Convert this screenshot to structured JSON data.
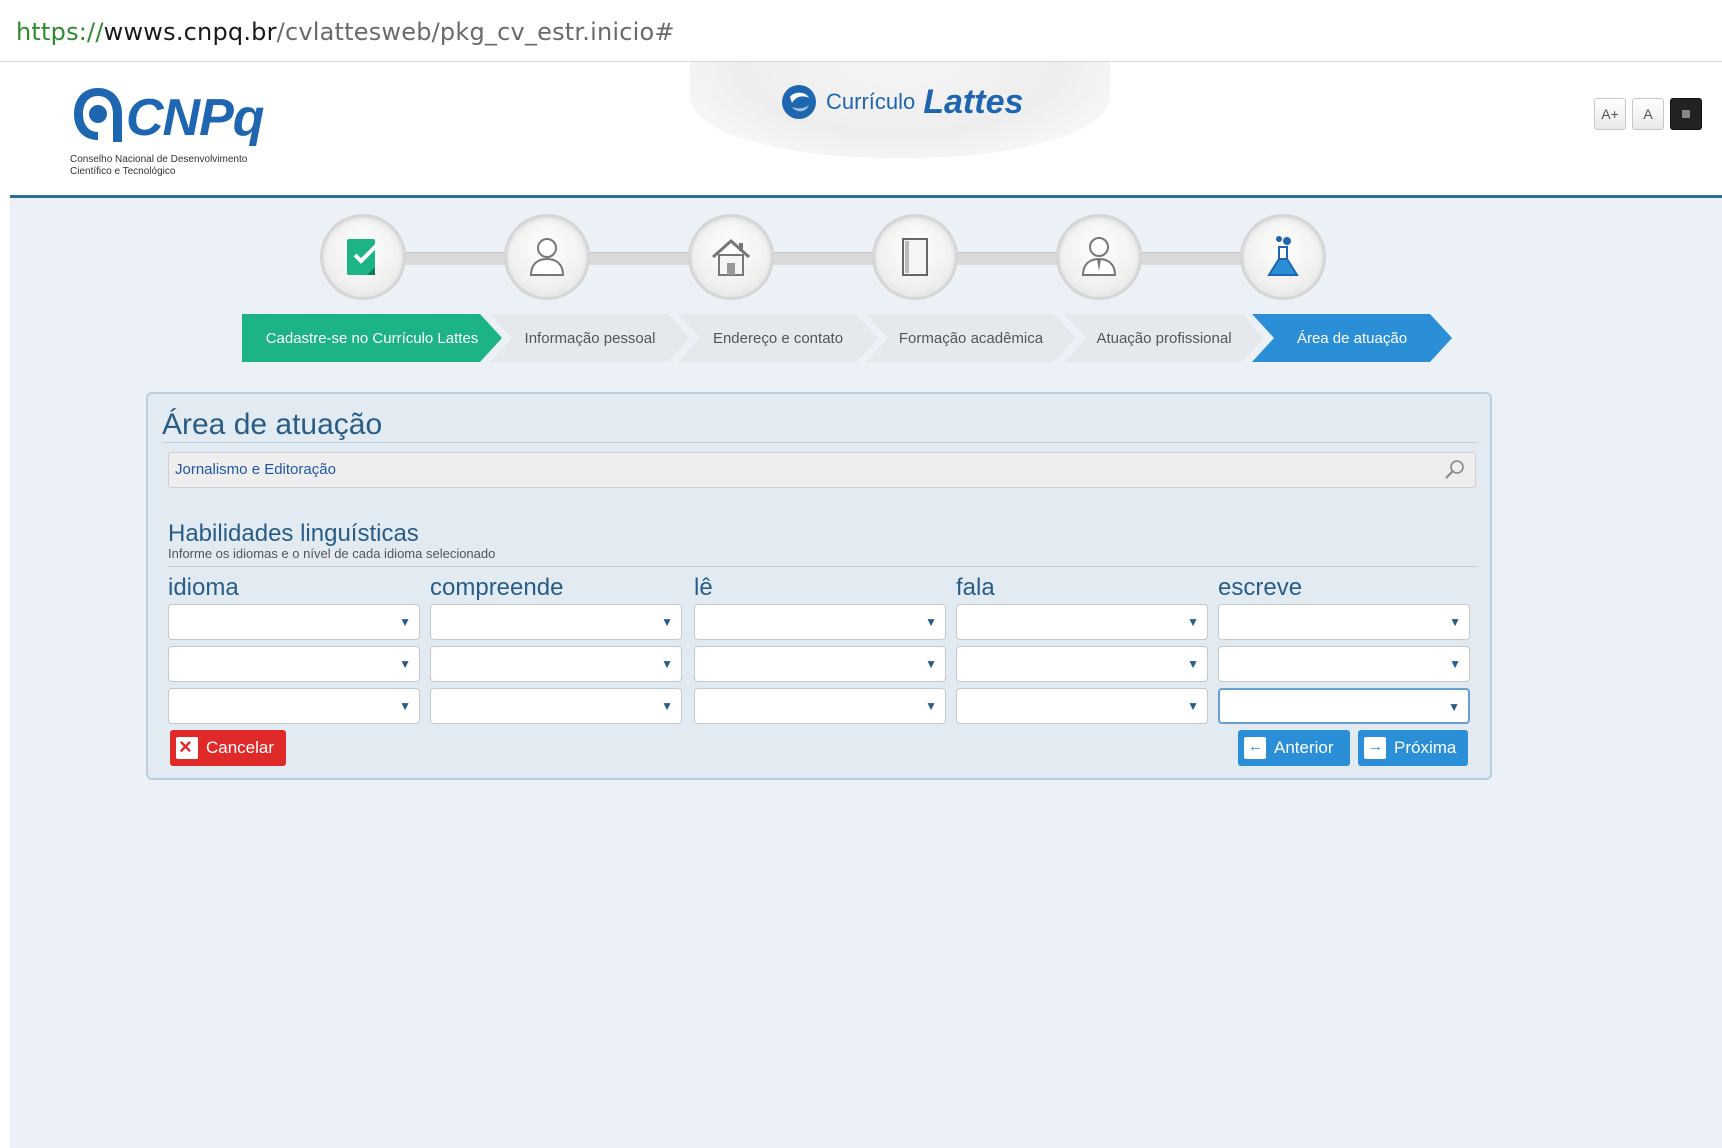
{
  "browser": {
    "url_scheme": "https://",
    "url_host": "wwws.cnpq.br",
    "url_path": "/cvlattesweb/pkg_cv_estr.inicio#"
  },
  "header": {
    "logo_text": "CNPq",
    "logo_subtitle_line1": "Conselho Nacional de Desenvolvimento",
    "logo_subtitle_line2": "Científico e Tecnológico",
    "brand_small": "Currículo",
    "brand_big": "Lattes",
    "access_buttons": [
      "A+",
      "A",
      ""
    ]
  },
  "steps": {
    "icons": [
      "checklist-icon",
      "person-icon",
      "house-icon",
      "book-icon",
      "professional-icon",
      "flask-icon"
    ],
    "crumbs": [
      "Cadastre-se no Currículo Lattes",
      "Informação pessoal",
      "Endereço e contato",
      "Formação acadêmica",
      "Atuação profissional",
      "Área de atuação"
    ],
    "active_index": 5
  },
  "panel": {
    "title": "Área de atuação",
    "area_value": "Jornalismo e Editoração",
    "languages_title": "Habilidades linguísticas",
    "languages_hint": "Informe os idiomas e o nível de cada idioma selecionado",
    "columns": [
      "idioma",
      "compreende",
      "lê",
      "fala",
      "escreve"
    ],
    "rows": 3,
    "buttons": {
      "cancel": "Cancelar",
      "previous": "Anterior",
      "next": "Próxima"
    }
  },
  "colors": {
    "brand_blue": "#1e67b0",
    "step_green": "#1cb386",
    "step_active": "#2a8fd6",
    "cancel_red": "#e02a2a"
  }
}
